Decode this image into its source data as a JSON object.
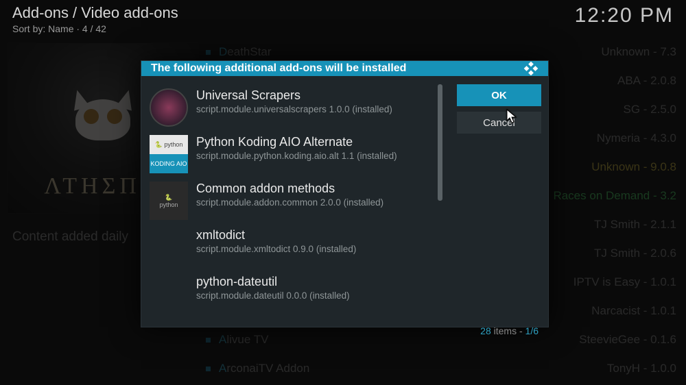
{
  "header": {
    "breadcrumb": "Add-ons / Video add-ons",
    "sort": "Sort by: Name  ·  4 / 42",
    "clock": "12:20 PM"
  },
  "thumbnail": {
    "logo_text": "ΛΤΗΣΠΛ"
  },
  "caption": "Content added daily",
  "bg_list": [
    {
      "first": "D",
      "rest": "eathStar",
      "meta": "Unknown - 7.3"
    },
    {
      "first": "",
      "rest": "",
      "meta": "ABA - 2.0.8"
    },
    {
      "first": "",
      "rest": "",
      "meta": "SG - 2.5.0"
    },
    {
      "first": "",
      "rest": "",
      "meta": "Nymeria - 4.3.0"
    },
    {
      "first": "",
      "rest": "",
      "meta": "Unknown - 9.0.8",
      "yellow": true
    },
    {
      "first": "",
      "rest": "",
      "meta": "Races on Demand - 3.2",
      "highlight": true
    },
    {
      "first": "",
      "rest": "",
      "meta": "TJ Smith - 2.1.1"
    },
    {
      "first": "",
      "rest": "",
      "meta": "TJ Smith - 2.0.6"
    },
    {
      "first": "",
      "rest": "",
      "meta": "IPTV is Easy - 1.0.1"
    },
    {
      "first": "",
      "rest": "",
      "meta": "Narcacist - 1.0.1"
    },
    {
      "first": "A",
      "rest": "livue TV",
      "meta": "SteevieGee - 0.1.6"
    },
    {
      "first": "A",
      "rest": "rconaiTV Addon",
      "meta": "TonyH - 1.0.0"
    }
  ],
  "dialog": {
    "title": "The following additional add-ons will be installed",
    "ok": "OK",
    "cancel": "Cancel",
    "items": [
      {
        "name": "Universal Scrapers",
        "sub": "script.module.universalscrapers 1.0.0 (installed)",
        "icon": "round"
      },
      {
        "name": "Python Koding AIO Alternate",
        "sub": "script.module.python.koding.aio.alt 1.1 (installed)",
        "icon": "split"
      },
      {
        "name": "Common addon methods",
        "sub": "script.module.addon.common 2.0.0 (installed)",
        "icon": "py"
      },
      {
        "name": "xmltodict",
        "sub": "script.module.xmltodict 0.9.0 (installed)",
        "icon": "empty"
      },
      {
        "name": "python-dateutil",
        "sub": "script.module.dateutil 0.0.0 (installed)",
        "icon": "empty"
      }
    ],
    "footer": {
      "count": "28",
      "mid": " items - ",
      "page": "1/6"
    }
  },
  "icons": {
    "split_top": "🐍 python",
    "split_bot": "KODING AIO",
    "py_top": "🐍",
    "py_bot": "python"
  }
}
